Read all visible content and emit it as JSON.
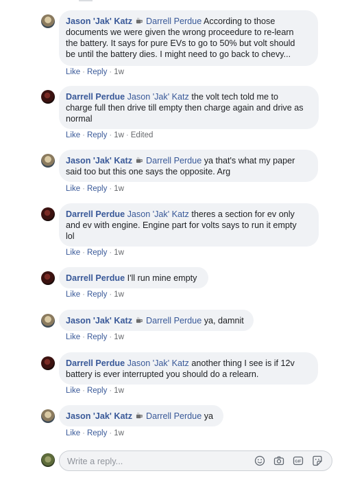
{
  "comments": [
    {
      "author": "Jason 'Jak' Katz",
      "author_cup": true,
      "mention": "Darrell Perdue",
      "lines": [
        "According to those",
        "documents we were given the wrong proceedure to re-learn",
        "the battery. It says for pure EVs to go to 50% but volt should",
        "be until the battery dies. I might need to go back to chevy..."
      ],
      "like": "Like",
      "reply": "Reply",
      "time": "1w",
      "edited": ""
    },
    {
      "author": "Darrell Perdue",
      "author_cup": false,
      "mention": "Jason 'Jak' Katz",
      "lines": [
        "the volt tech told me to",
        "charge full then drive till empty then charge again and drive as",
        "normal"
      ],
      "like": "Like",
      "reply": "Reply",
      "time": "1w",
      "edited": "Edited"
    },
    {
      "author": "Jason 'Jak' Katz",
      "author_cup": true,
      "mention": "Darrell Perdue",
      "lines": [
        "ya that's what my paper",
        "said too but this one says the opposite. Arg"
      ],
      "like": "Like",
      "reply": "Reply",
      "time": "1w",
      "edited": ""
    },
    {
      "author": "Darrell Perdue",
      "author_cup": false,
      "mention": "Jason 'Jak' Katz",
      "lines": [
        "theres a section for ev only",
        "and ev with engine. Engine part for volts says to run it empty",
        "lol"
      ],
      "like": "Like",
      "reply": "Reply",
      "time": "1w",
      "edited": ""
    },
    {
      "author": "Darrell Perdue",
      "author_cup": false,
      "mention": "",
      "lines": [
        "I'll run mine empty"
      ],
      "like": "Like",
      "reply": "Reply",
      "time": "1w",
      "edited": ""
    },
    {
      "author": "Jason 'Jak' Katz",
      "author_cup": true,
      "mention": "Darrell Perdue",
      "lines": [
        "ya, damnit"
      ],
      "like": "Like",
      "reply": "Reply",
      "time": "1w",
      "edited": ""
    },
    {
      "author": "Darrell Perdue",
      "author_cup": false,
      "mention": "Jason 'Jak' Katz",
      "lines": [
        "another thing I see is if 12v",
        "battery is ever interrupted you should do a relearn."
      ],
      "like": "Like",
      "reply": "Reply",
      "time": "1w",
      "edited": ""
    },
    {
      "author": "Jason 'Jak' Katz",
      "author_cup": true,
      "mention": "Darrell Perdue",
      "lines": [
        "ya"
      ],
      "like": "Like",
      "reply": "Reply",
      "time": "1w",
      "edited": ""
    }
  ],
  "reply_box": {
    "placeholder": "Write a reply...",
    "icons": [
      "emoji-icon",
      "camera-icon",
      "gif-icon",
      "sticker-icon"
    ]
  },
  "colors": {
    "link": "#385898",
    "bubble": "#f0f2f5",
    "meta": "#65676b"
  }
}
